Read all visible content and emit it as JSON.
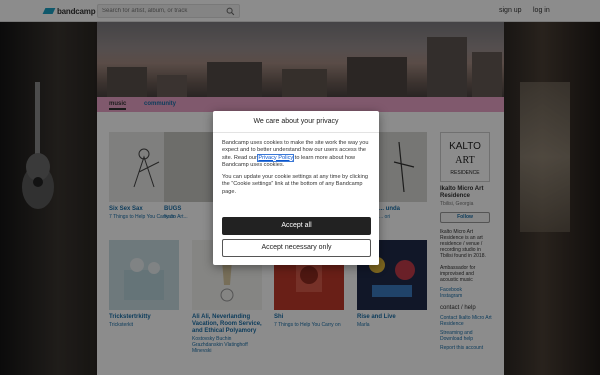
{
  "topbar": {
    "logo_text": "bandcamp",
    "search_placeholder": "Search for artist, album, or track",
    "signup": "sign up",
    "login": "log in"
  },
  "tabs": {
    "music": "music",
    "community": "community"
  },
  "albums": [
    {
      "title": "Six Sex Sax",
      "artist": "7 Things to Help You Carry on"
    },
    {
      "title": "BUGS",
      "artist": "Ikalto Art..."
    },
    {
      "title": "",
      "artist": ""
    },
    {
      "title": "... unda",
      "artist": "... ori"
    },
    {
      "title": "Trickstertrkitty",
      "artist": "Tricksterkit"
    },
    {
      "title": "Ali Ali, Neverlanding Vacation, Room Service, and Ethical Polyamory",
      "artist": "Kostovsky Buchin Grazhdanskin Vlatinghoff Minevski"
    },
    {
      "title": "Shi",
      "artist": "7 Things to Help You Carry on"
    },
    {
      "title": "Rise and Live",
      "artist": "Marla"
    }
  ],
  "sidebar": {
    "logo_text": "KALTO ART RESIDENCE",
    "name": "Ikalto Micro Art Residence",
    "location": "Tbilisi, Georgia",
    "follow": "Follow",
    "bio": "Ikalto Micro Art Residence is an art residence / venue / recording studio in Tbilisi found in 2018.",
    "ambassador": "Ambassador for improvised and acoustic music",
    "links": [
      "Facebook",
      "Instagram"
    ],
    "contact_head": "contact / help",
    "contact_links": [
      "Contact Ikalto Micro Art Residence",
      "Streaming and Download help",
      "Report this account"
    ]
  },
  "modal": {
    "title": "We care about your privacy",
    "p1_before": "Bandcamp uses cookies to make the site work the way you expect and to better understand how our users access the site. Read our ",
    "policy_link": "Privacy Policy",
    "p1_after": " to learn more about how Bandcamp uses cookies.",
    "p2": "You can update your cookie settings at any time by clicking the “Cookie settings” link at the bottom of any Bandcamp page.",
    "accept_all": "Accept all",
    "accept_necessary": "Accept necessary only"
  }
}
